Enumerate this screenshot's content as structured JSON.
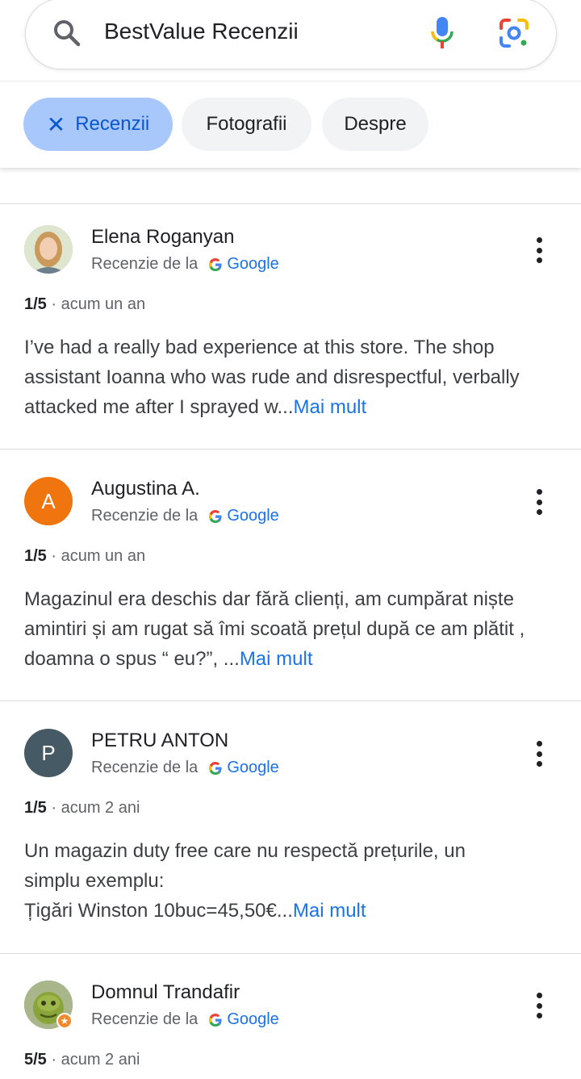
{
  "search": {
    "query": "BestValue Recenzii"
  },
  "chips": {
    "recenzii": "Recenzii",
    "fotografii": "Fotografii",
    "despre": "Despre"
  },
  "common": {
    "source_prefix": "Recenzie de la",
    "source_brand": "Google",
    "more_label": "Mai mult"
  },
  "reviews": [
    {
      "name": "Elena Roganyan",
      "avatar": {
        "type": "photo",
        "color": "#c9b38d"
      },
      "rating": "1/5",
      "time": "· acum un an",
      "text": "I’ve had a really bad experience at this store. The shop assistant Ioanna who was rude and disrespectful, verbally attacked me after I sprayed w..."
    },
    {
      "name": "Augustina A.",
      "avatar": {
        "type": "letter",
        "letter": "A",
        "color": "#f0750f"
      },
      "rating": "1/5",
      "time": "· acum un an",
      "text": "Magazinul era deschis dar fără clienți, am cumpărat niște amintiri și am rugat să îmi scoată prețul după ce am plătit , doamna o spus “ eu?”, ..."
    },
    {
      "name": "PETRU ANTON",
      "avatar": {
        "type": "letter",
        "letter": "P",
        "color": "#455a64"
      },
      "rating": "1/5",
      "time": "· acum 2 ani",
      "text_line1": "Un magazin duty free care nu respectă prețurile, un simplu exemplu:",
      "text_line2": "Țigări Winston 10buc=45,50€..."
    },
    {
      "name": "Domnul Trandafir",
      "avatar": {
        "type": "photo",
        "color": "#7a8f3a"
      },
      "rating": "5/5",
      "time": "· acum 2 ani"
    }
  ]
}
